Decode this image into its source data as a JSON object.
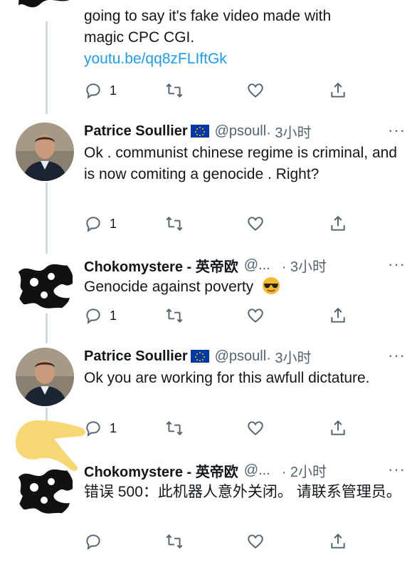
{
  "tweets": [
    {
      "partial_top_text": "going to say it's fake video made with",
      "partial_top_text2": "magic CPC CGI.",
      "link": "youtu.be/qq8zFLIftGk",
      "reply_count": "1"
    },
    {
      "name": "Patrice Soullier",
      "handle": "@psoull",
      "time": "· 3小时",
      "text": "Ok . communist chinese regime is criminal, and is now comiting a genocide . Right?",
      "reply_count": "1"
    },
    {
      "name": "Chokomystere - 英帝欧",
      "handle": "@...",
      "time": "· 3小时",
      "text": "Genocide against poverty",
      "reply_count": "1"
    },
    {
      "name": "Patrice Soullier",
      "handle": "@psoull",
      "time": "· 3小时",
      "text": "Ok you are working for this awfull dictature.",
      "reply_count": "1"
    },
    {
      "name": "Chokomystere - 英帝欧",
      "handle": "@...",
      "time": "· 2小时",
      "text": "错误 500：此机器人意外关闭。 请联系管理员。",
      "reply_count": ""
    }
  ],
  "more_label": "···",
  "icons": {
    "reply": "reply-icon",
    "retweet": "retweet-icon",
    "like": "like-icon",
    "share": "share-icon",
    "flag": "eu-flag-icon",
    "emoji": "sunglasses-emoji"
  },
  "colors": {
    "link": "#1d9bf0",
    "muted": "#536471",
    "text": "#14171a",
    "thread_line": "#cfd9de"
  }
}
